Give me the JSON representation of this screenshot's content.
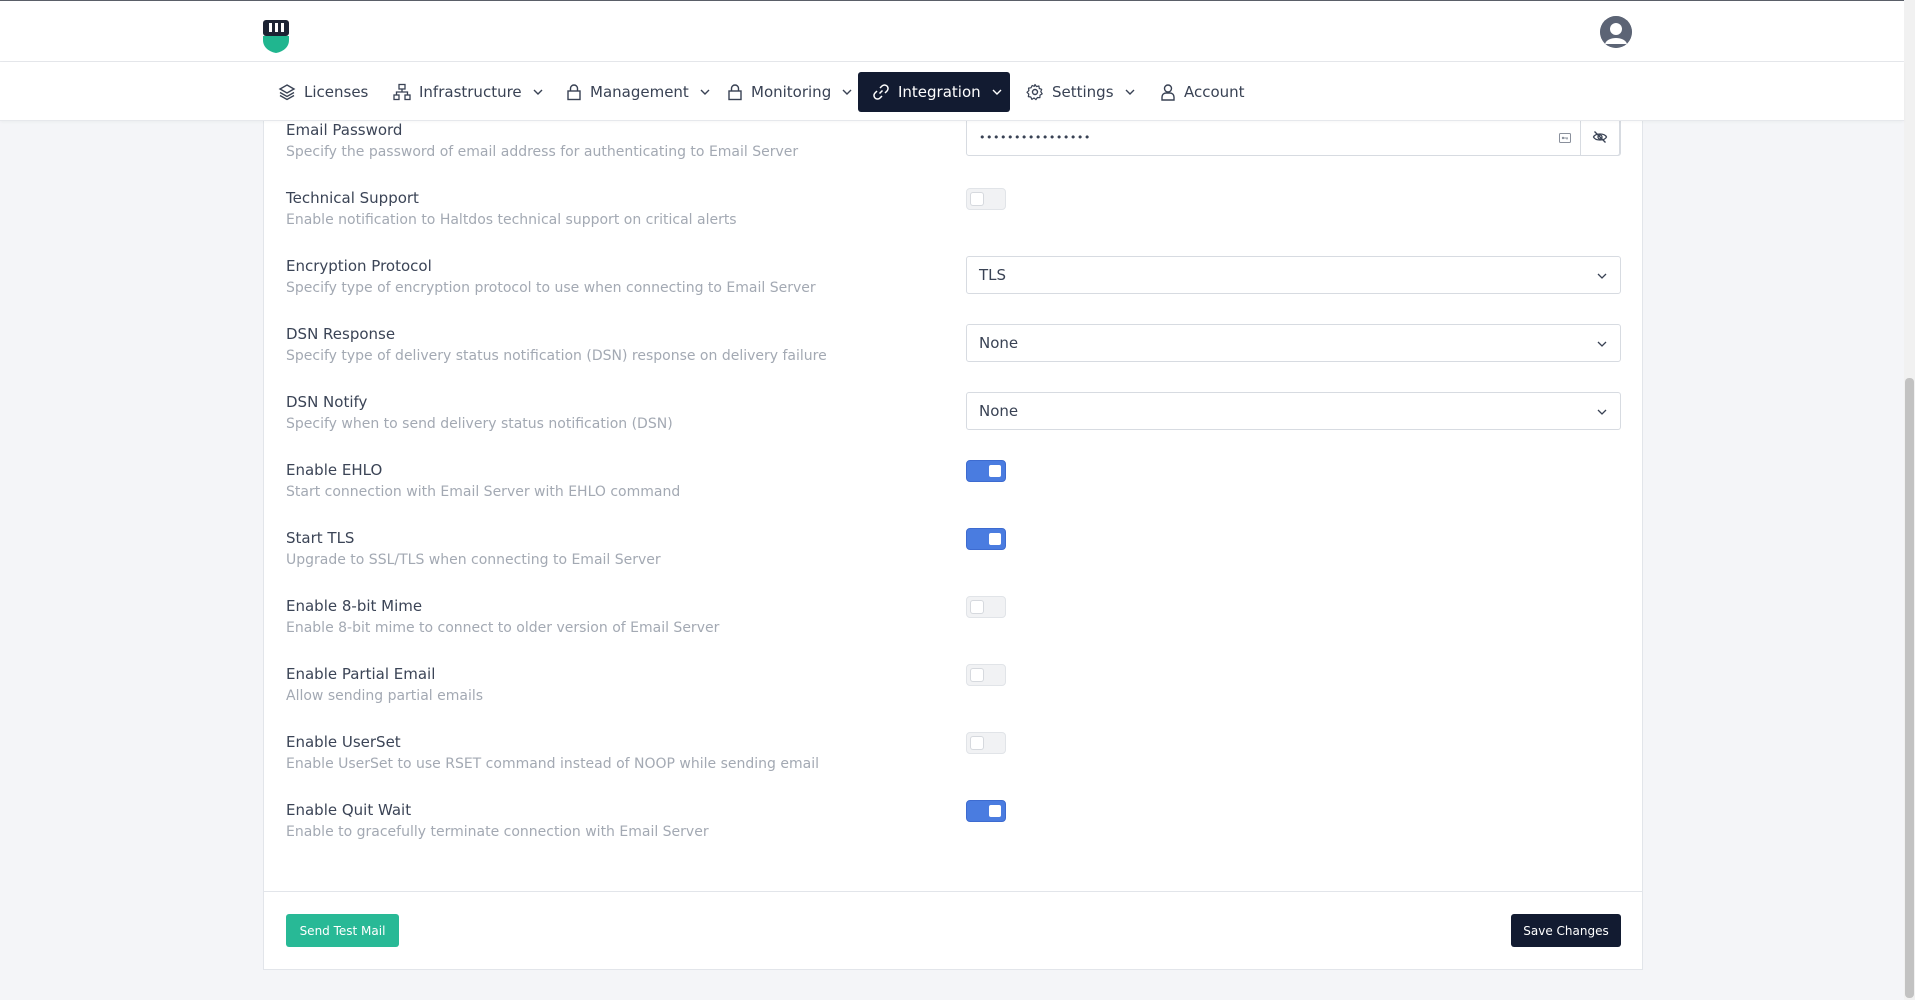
{
  "nav": {
    "items": [
      {
        "label": "Licenses",
        "icon": "layers-icon",
        "has_dropdown": false,
        "active": false
      },
      {
        "label": "Infrastructure",
        "icon": "network-icon",
        "has_dropdown": true,
        "active": false
      },
      {
        "label": "Management",
        "icon": "lock-icon",
        "has_dropdown": true,
        "active": false
      },
      {
        "label": "Monitoring",
        "icon": "lock-icon",
        "has_dropdown": true,
        "active": false
      },
      {
        "label": "Integration",
        "icon": "link-icon",
        "has_dropdown": true,
        "active": true
      },
      {
        "label": "Settings",
        "icon": "gear-icon",
        "has_dropdown": true,
        "active": false
      },
      {
        "label": "Account",
        "icon": "user-icon",
        "has_dropdown": false,
        "active": false
      }
    ]
  },
  "settings": {
    "email_password": {
      "title": "Email Password",
      "desc": "Specify the password of email address for authenticating to Email Server",
      "value": "••••••••••••••••"
    },
    "technical_support": {
      "title": "Technical Support",
      "desc": "Enable notification to Haltdos technical support on critical alerts",
      "enabled": false
    },
    "encryption_protocol": {
      "title": "Encryption Protocol",
      "desc": "Specify type of encryption protocol to use when connecting to Email Server",
      "value": "TLS"
    },
    "dsn_response": {
      "title": "DSN Response",
      "desc": "Specify type of delivery status notification (DSN) response on delivery failure",
      "value": "None"
    },
    "dsn_notify": {
      "title": "DSN Notify",
      "desc": "Specify when to send delivery status notification (DSN)",
      "value": "None"
    },
    "enable_ehlo": {
      "title": "Enable EHLO",
      "desc": "Start connection with Email Server with EHLO command",
      "enabled": true
    },
    "start_tls": {
      "title": "Start TLS",
      "desc": "Upgrade to SSL/TLS when connecting to Email Server",
      "enabled": true
    },
    "enable_8bit_mime": {
      "title": "Enable 8-bit Mime",
      "desc": "Enable 8-bit mime to connect to older version of Email Server",
      "enabled": false
    },
    "enable_partial_email": {
      "title": "Enable Partial Email",
      "desc": "Allow sending partial emails",
      "enabled": false
    },
    "enable_userset": {
      "title": "Enable UserSet",
      "desc": "Enable UserSet to use RSET command instead of NOOP while sending email",
      "enabled": false
    },
    "enable_quit_wait": {
      "title": "Enable Quit Wait",
      "desc": "Enable to gracefully terminate connection with Email Server",
      "enabled": true
    }
  },
  "actions": {
    "send_test_label": "Send Test Mail",
    "save_label": "Save Changes"
  },
  "colors": {
    "accent_dark": "#121b31",
    "toggle_on": "#4a7ce0",
    "teal_button": "#28b996"
  }
}
